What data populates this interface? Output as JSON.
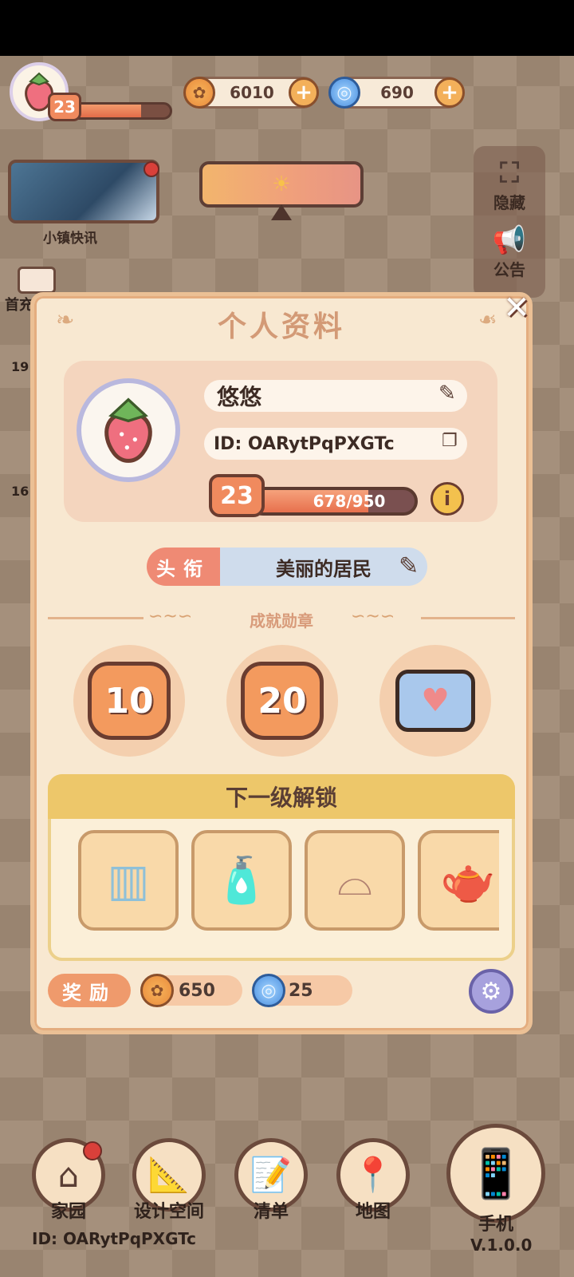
{
  "hud": {
    "player_level": "23",
    "level_progress": 0.72,
    "coins": "6010",
    "gems": "690",
    "plus_symbol": "+",
    "coin_icon": "coin-icon",
    "gem_icon": "gem-icon"
  },
  "news": {
    "label": "小镇快讯"
  },
  "side": {
    "hide_label": "隐藏",
    "notice_label": "公告"
  },
  "left_strip": {
    "top_label": "首充",
    "num_1": "19",
    "num_2": "16"
  },
  "profile": {
    "title": "个人资料",
    "close": "✕",
    "name": "悠悠",
    "id_text": "ID: OARytPqPXGTc",
    "level": "23",
    "xp_text": "678/950",
    "xp_progress": 0.7137,
    "info": "i",
    "title_tag": "头衔",
    "title_value": "美丽的居民",
    "achievements_label": "成就勋章",
    "medals": [
      "10",
      "20",
      "♥"
    ],
    "unlock_title": "下一级解锁",
    "unlock_items": [
      "cabinet-icon",
      "detergent-icon",
      "shelf-icon",
      "kettle-icon"
    ],
    "reward_label": "奖励",
    "reward_coins": "650",
    "reward_gems": "25"
  },
  "nav": {
    "home": "家园",
    "design": "设计空间",
    "list": "清单",
    "map": "地图",
    "phone": "手机",
    "id_text": "ID: OARytPqPXGTc",
    "version": "V.1.0.0"
  },
  "colors": {
    "accent": "#f08a5e",
    "modal_bg": "#f8e8d1",
    "title_color": "#d39a76",
    "badge_red": "#d9403a"
  }
}
